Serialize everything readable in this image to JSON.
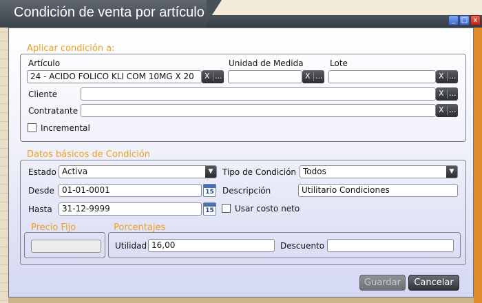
{
  "window": {
    "title": "Condición de venta por artículo",
    "buttons": {
      "minimize": "_",
      "maximize": "□",
      "close": "x"
    }
  },
  "aplicar": {
    "legend": "Aplicar condición a:",
    "articulo_label": "Artículo",
    "articulo_value": "24 - ACIDO FOLICO KLI COM 10MG X 20",
    "unidad_label": "Unidad de Medida",
    "unidad_value": "",
    "lote_label": "Lote",
    "lote_value": "",
    "cliente_label": "Cliente",
    "cliente_value": "",
    "contratante_label": "Contratante",
    "contratante_value": "",
    "incremental_label": "Incremental",
    "incremental_checked": false,
    "clear_label": "X",
    "search_label": "..."
  },
  "datos": {
    "legend": "Datos básicos de Condición",
    "estado_label": "Estado",
    "estado_value": "Activa",
    "tipo_label": "Tipo de Condición",
    "tipo_value": "Todos",
    "desde_label": "Desde",
    "desde_value": "01-01-0001",
    "descripcion_label": "Descripción",
    "descripcion_value": "Utilitario Condiciones",
    "hasta_label": "Hasta",
    "hasta_value": "31-12-9999",
    "costo_label": "Usar costo neto",
    "costo_checked": false,
    "calendar_number": "15"
  },
  "precio": {
    "legend": "Precio Fijo",
    "value": ""
  },
  "porcentajes": {
    "legend": "Porcentajes",
    "utilidad_label": "Utilidad",
    "utilidad_value": "16,00",
    "descuento_label": "Descuento",
    "descuento_value": ""
  },
  "footer": {
    "guardar": "Guardar",
    "cancelar": "Cancelar"
  },
  "icons": {
    "dropdown": "▼"
  }
}
